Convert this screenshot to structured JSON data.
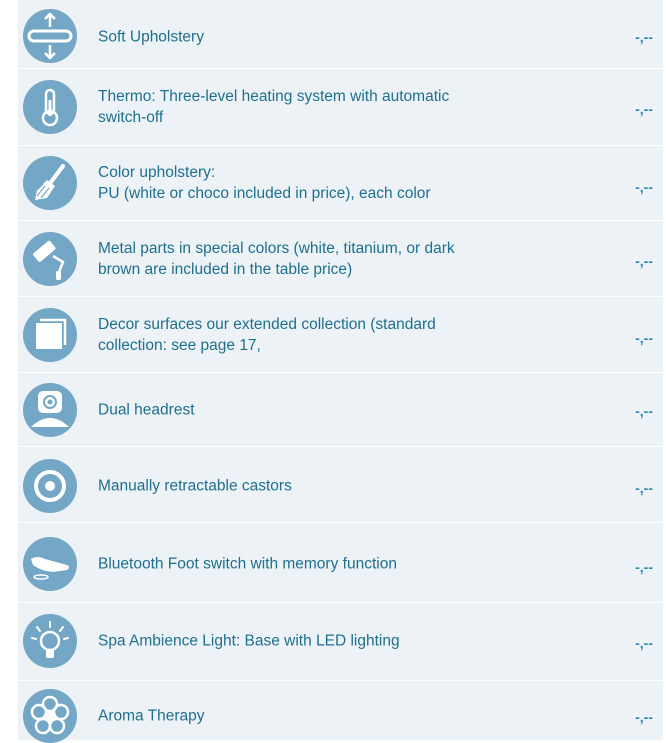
{
  "options": [
    {
      "icon": "adjustable-upholstery-icon",
      "lines": [
        "Soft Upholstery"
      ],
      "price": "-,--"
    },
    {
      "icon": "thermometer-icon",
      "lines": [
        "Thermo: Three-level heating system with automatic",
        "switch-off"
      ],
      "price": "-,--"
    },
    {
      "icon": "paintbrush-icon",
      "lines": [
        "Color upholstery:",
        "PU (white or choco included in price), each color"
      ],
      "price": "-,--"
    },
    {
      "icon": "paint-roller-icon",
      "lines": [
        "Metal parts in special colors (white, titanium, or dark",
        "brown are included in the table price)"
      ],
      "price": "-,--"
    },
    {
      "icon": "decor-surface-icon",
      "lines": [
        "Decor surfaces  our extended collection (standard",
        "collection: see page 17,"
      ],
      "price": "-,--"
    },
    {
      "icon": "headrest-icon",
      "lines": [
        "Dual headrest"
      ],
      "price": "-,--"
    },
    {
      "icon": "castor-icon",
      "lines": [
        "Manually retractable castors"
      ],
      "price": "-,--"
    },
    {
      "icon": "foot-switch-icon",
      "lines": [
        "Bluetooth Foot switch with memory function"
      ],
      "price": "-,--"
    },
    {
      "icon": "light-bulb-icon",
      "lines": [
        "Spa Ambience Light: Base with LED lighting"
      ],
      "price": "-,--"
    },
    {
      "icon": "flower-icon",
      "lines": [
        "Aroma Therapy"
      ],
      "price": "-,--"
    }
  ],
  "colors": {
    "panel": "#ecf2f6",
    "icon_fill": "#73a7c5",
    "label_text": "#1f6f8e",
    "price_text": "#2b89ad"
  }
}
